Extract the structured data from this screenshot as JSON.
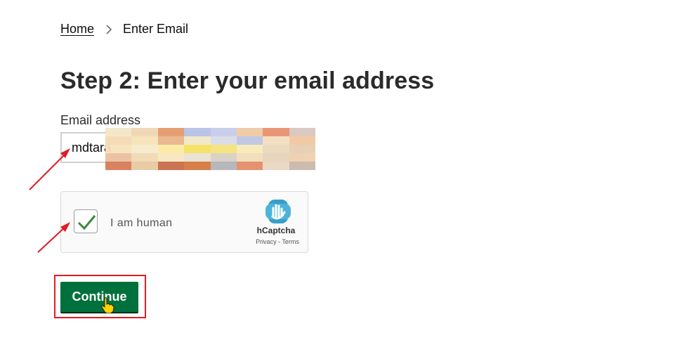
{
  "breadcrumb": {
    "home_label": "Home",
    "current_label": "Enter Email",
    "separator_icon": "chevron-right-icon"
  },
  "page": {
    "title": "Step 2: Enter your email address"
  },
  "email": {
    "label": "Email address",
    "value": "mdtara"
  },
  "captcha": {
    "checked": true,
    "label": "I am human",
    "brand": "hCaptcha",
    "privacy_label": "Privacy",
    "links_separator": " - ",
    "terms_label": "Terms",
    "logo_icon": "hcaptcha-hand-icon",
    "check_icon": "checkmark-icon"
  },
  "actions": {
    "continue_label": "Continue"
  },
  "colors": {
    "primary_button": "#00703c",
    "annotation_red": "#e01b24",
    "checkmark": "#3a8a3a"
  }
}
